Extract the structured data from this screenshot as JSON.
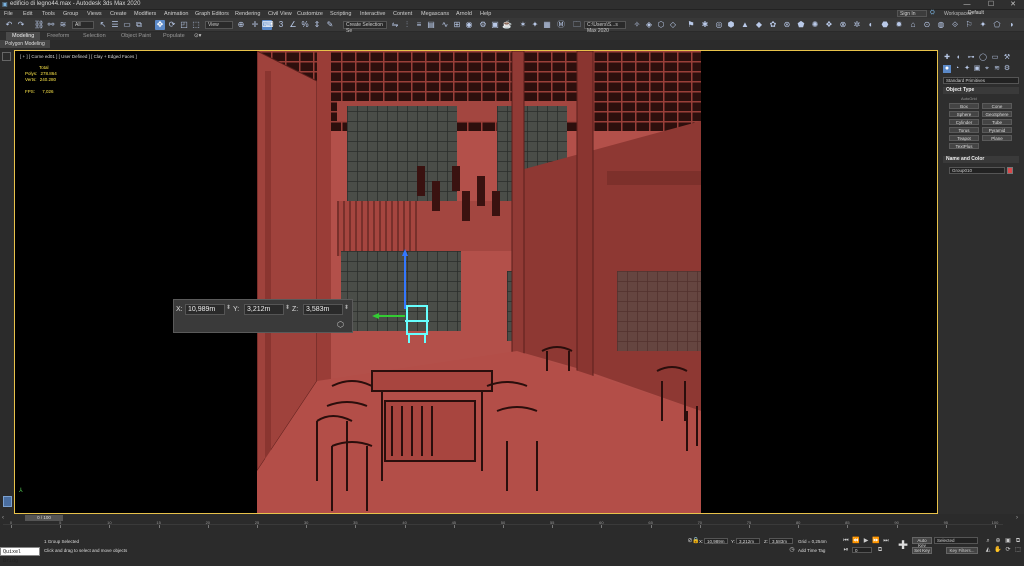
{
  "window": {
    "title": "edificio di legno44.max - Autodesk 3ds Max 2020",
    "minimize_glyph": "—",
    "maximize_glyph": "☐",
    "close_glyph": "✕"
  },
  "menu": [
    "File",
    "Edit",
    "Tools",
    "Group",
    "Views",
    "Create",
    "Modifiers",
    "Animation",
    "Graph Editors",
    "Rendering",
    "Civil View",
    "Customize",
    "Scripting",
    "Interactive",
    "Content",
    "Megascans",
    "Arnold",
    "Help"
  ],
  "account": {
    "sign_in": "Sign In",
    "workspaces_label": "Workspaces:",
    "workspace_value": "Default"
  },
  "toolbar": {
    "filter_value": "All",
    "ref_coord_value": "View",
    "selection_set_placeholder": "Create Selection Se",
    "project_path": "C:\\Users\\S...s Max 2020"
  },
  "ribbon_tabs": [
    {
      "label": "Modeling",
      "active": true
    },
    {
      "label": "Freeform",
      "active": false
    },
    {
      "label": "Selection",
      "active": false
    },
    {
      "label": "Object Paint",
      "active": false
    },
    {
      "label": "Populate",
      "active": false
    }
  ],
  "polygon_modeling": "Polygon Modeling",
  "viewport": {
    "label": "[ + ] [ Corne ed01 ] [ User Defined ] [ Clay + Edged Faces ]",
    "stats": {
      "total_label": "Total",
      "polys_label": "Polys:",
      "polys_value": "278.864",
      "verts_label": "Verts:",
      "verts_value": "240.280",
      "fps_label": "FPS:",
      "fps_value": "7,026"
    },
    "border_color": "#e8c24a",
    "clay_color": "#b5504a"
  },
  "transform_typein": {
    "x_label": "X:",
    "x_value": "10,989m",
    "y_label": "Y:",
    "y_value": "3,212m",
    "z_label": "Z:",
    "z_value": "3,583m"
  },
  "command_panel": {
    "category_value": "Standard Primitives",
    "object_type_title": "Object Type",
    "autogrid_label": "AutoGrid",
    "objects": [
      "Box",
      "Cone",
      "Sphere",
      "GeoSphere",
      "Cylinder",
      "Tube",
      "Torus",
      "Pyramid",
      "Teapot",
      "Plane",
      "TextPlus"
    ],
    "name_color_title": "Name and Color",
    "object_name": "Group010",
    "object_color": "#d9484b"
  },
  "timeline": {
    "frame_display": "0 / 100",
    "ticks": [
      "0",
      "5",
      "10",
      "15",
      "20",
      "25",
      "30",
      "35",
      "40",
      "45",
      "50",
      "55",
      "60",
      "65",
      "70",
      "75",
      "80",
      "85",
      "90",
      "95",
      "100"
    ]
  },
  "statusbar": {
    "maxscript_label": "Quixel Bridg",
    "selection_status": "1 Group Selected",
    "prompt": "Click and drag to select and move objects",
    "x_label": "X:",
    "x_value": "10,989m",
    "y_label": "Y:",
    "y_value": "3,212m",
    "z_label": "Z:",
    "z_value": "3,583m",
    "grid": "Grid = 0,254m",
    "add_time_tag": "Add Time Tag",
    "auto_key": "Auto Key",
    "set_key": "Set Key",
    "selected_value": "Selected",
    "key_filters": "Key Filters...",
    "frame_value": "0"
  }
}
